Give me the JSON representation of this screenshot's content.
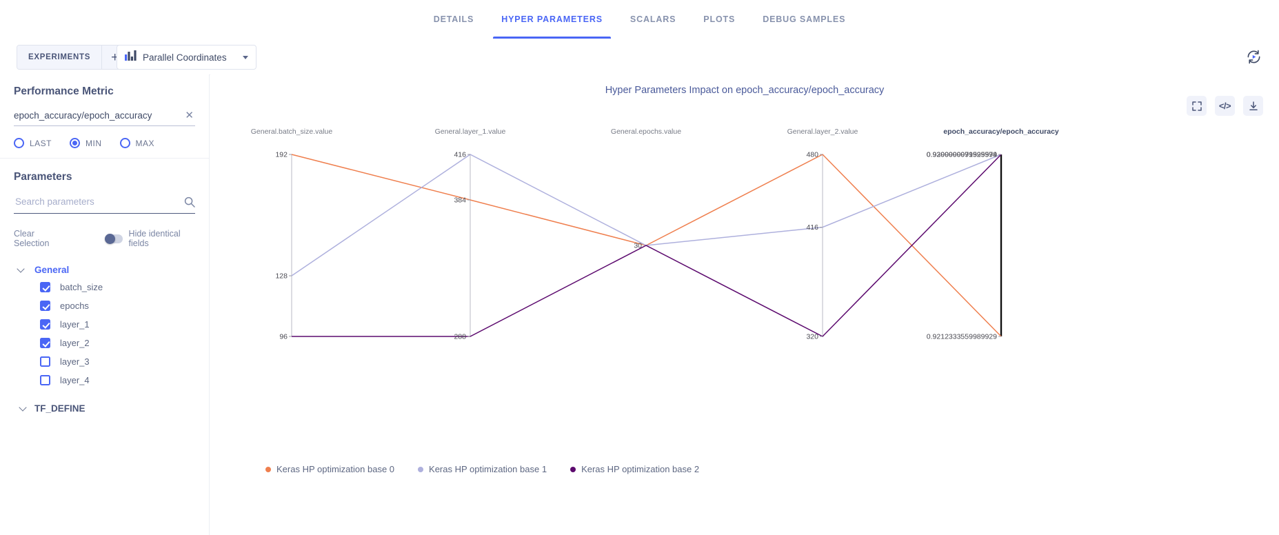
{
  "tabs": [
    {
      "label": "DETAILS",
      "active": false
    },
    {
      "label": "HYPER PARAMETERS",
      "active": true
    },
    {
      "label": "SCALARS",
      "active": false
    },
    {
      "label": "PLOTS",
      "active": false
    },
    {
      "label": "DEBUG SAMPLES",
      "active": false
    }
  ],
  "toolbar": {
    "experiments_label": "EXPERIMENTS",
    "add_label": "+",
    "view_select_value": "Parallel Coordinates",
    "refresh_icon": "auto-refresh-icon"
  },
  "sidebar": {
    "performance_metric": {
      "title": "Performance Metric",
      "value": "epoch_accuracy/epoch_accuracy",
      "clear_icon": "close-icon",
      "aggregations": [
        {
          "label": "LAST",
          "selected": false
        },
        {
          "label": "MIN",
          "selected": true
        },
        {
          "label": "MAX",
          "selected": false
        }
      ]
    },
    "parameters": {
      "title": "Parameters",
      "search_placeholder": "Search parameters",
      "search_value": "",
      "search_icon": "search-icon",
      "clear_selection_label": "Clear Selection",
      "hide_identical_label": "Hide identical fields",
      "hide_identical_on": false,
      "groups": [
        {
          "name": "General",
          "expanded": true,
          "items": [
            {
              "label": "batch_size",
              "checked": true
            },
            {
              "label": "epochs",
              "checked": true
            },
            {
              "label": "layer_1",
              "checked": true
            },
            {
              "label": "layer_2",
              "checked": true
            },
            {
              "label": "layer_3",
              "checked": false
            },
            {
              "label": "layer_4",
              "checked": false
            }
          ]
        },
        {
          "name": "TF_DEFINE",
          "expanded": false,
          "items": []
        }
      ]
    }
  },
  "main": {
    "title": "Hyper Parameters Impact on epoch_accuracy/epoch_accuracy",
    "actions": [
      {
        "name": "fullscreen-icon",
        "label": ""
      },
      {
        "name": "code-icon",
        "label": "</>"
      },
      {
        "name": "download-icon",
        "label": ""
      }
    ]
  },
  "chart_data": {
    "type": "line",
    "subtype": "parallel-coordinates",
    "title": "Hyper Parameters Impact on epoch_accuracy/epoch_accuracy",
    "xlabel": "",
    "ylabel": "",
    "grid": false,
    "legend_position": "bottom-left",
    "axes": [
      {
        "name": "General.batch_size.value",
        "ticks": [
          "192",
          "128",
          "96"
        ],
        "tick_values": [
          192,
          128,
          96
        ],
        "range": [
          96,
          192
        ]
      },
      {
        "name": "General.layer_1.value",
        "ticks": [
          "416",
          "384",
          "288"
        ],
        "tick_values": [
          416,
          384,
          288
        ],
        "range": [
          288,
          416
        ]
      },
      {
        "name": "General.epochs.value",
        "ticks": [
          "30"
        ],
        "tick_values": [
          30
        ],
        "range": [
          30,
          30
        ]
      },
      {
        "name": "General.layer_2.value",
        "ticks": [
          "480",
          "416",
          "320"
        ],
        "tick_values": [
          480,
          416,
          320
        ],
        "range": [
          320,
          480
        ]
      },
      {
        "name": "epoch_accuracy/epoch_accuracy",
        "ticks": [
          "0.9300000071525574",
          "0.9299999999999999",
          "0.9212333559989929"
        ],
        "tick_values": [
          0.9300000071525574,
          0.9299999999999999,
          0.9212333559989929
        ],
        "range": [
          0.9212333559989929,
          0.9300000071525574
        ]
      }
    ],
    "series": [
      {
        "name": "Keras HP optimization base 0",
        "color": "#ef7f4e",
        "values": [
          192,
          384,
          30,
          480,
          0.9212333559989929
        ]
      },
      {
        "name": "Keras HP optimization base 1",
        "color": "#aeb0dd",
        "values": [
          128,
          416,
          30,
          416,
          0.9300000071525574
        ]
      },
      {
        "name": "Keras HP optimization base 2",
        "color": "#5c0a6e",
        "values": [
          96,
          288,
          30,
          320,
          0.9299999999999999
        ]
      }
    ]
  },
  "colors": {
    "accent": "#4a66f5",
    "text": "#3f4a66",
    "muted": "#7b86a4",
    "series0": "#ef7f4e",
    "series1": "#aeb0dd",
    "series2": "#5c0a6e"
  }
}
